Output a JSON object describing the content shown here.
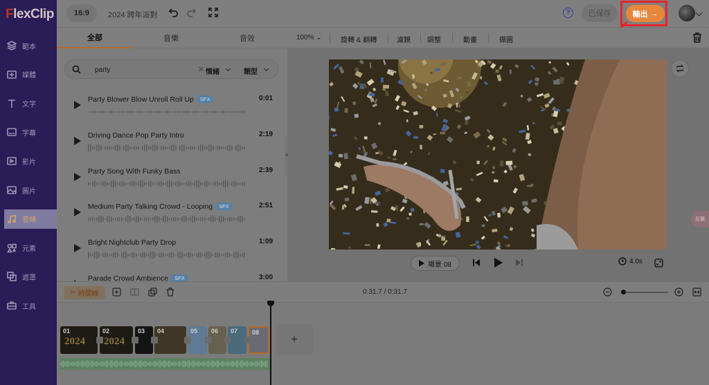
{
  "app": {
    "logo": "FlexClip"
  },
  "sidebar": {
    "items": [
      {
        "label": "範本",
        "icon": "layers-icon"
      },
      {
        "label": "媒體",
        "icon": "media-icon"
      },
      {
        "label": "文字",
        "icon": "text-icon"
      },
      {
        "label": "字幕",
        "icon": "subtitle-icon"
      },
      {
        "label": "影片",
        "icon": "video-icon"
      },
      {
        "label": "圖片",
        "icon": "image-icon"
      },
      {
        "label": "音頻",
        "icon": "music-icon",
        "active": true
      },
      {
        "label": "元素",
        "icon": "elements-icon"
      },
      {
        "label": "遮罩",
        "icon": "overlay-icon"
      },
      {
        "label": "工具",
        "icon": "tools-icon"
      }
    ]
  },
  "topbar": {
    "ratio": "16:9",
    "project_name": "2024 跨年派對",
    "help": "?",
    "saved": "已保存",
    "export": "輸出",
    "export_arrow": "→"
  },
  "tabs": [
    "全部",
    "音樂",
    "音效"
  ],
  "toolbar": {
    "zoom": "100%",
    "items": [
      "旋轉 & 翻轉",
      "濾鏡",
      "調整",
      "動畫",
      "擷圖"
    ]
  },
  "search": {
    "query": "party",
    "clear": "✕",
    "filters": [
      "情緒",
      "類型"
    ]
  },
  "tracks": [
    {
      "name": "Party Blower Blow Unroll Roll Up",
      "badge": "SFX",
      "duration": "0:01"
    },
    {
      "name": "Driving Dance Pop Party Intro",
      "badge": "",
      "duration": "2:19"
    },
    {
      "name": "Party Song With Funky Bass",
      "badge": "",
      "duration": "2:39"
    },
    {
      "name": "Medium Party Talking Crowd - Looping",
      "badge": "SFX",
      "duration": "2:51"
    },
    {
      "name": "Bright Nightclub Party Drop",
      "badge": "",
      "duration": "1:09"
    },
    {
      "name": "Parade Crowd Ambience",
      "badge": "SFX",
      "duration": "3:00"
    }
  ],
  "player": {
    "scene": "場景 08",
    "duration": "4.0s"
  },
  "feedback": "反饋",
  "timeline": {
    "button": "時間線",
    "time": "0:31.7 / 0:31.7",
    "add": "+",
    "clips": [
      "01",
      "02",
      "03",
      "04",
      "05",
      "06",
      "07",
      "08"
    ]
  },
  "colors": {
    "accent": "#f5923e",
    "highlight": "#e5262c",
    "sidebar": "#2a1c57",
    "active_tab": "#f5a55c"
  }
}
